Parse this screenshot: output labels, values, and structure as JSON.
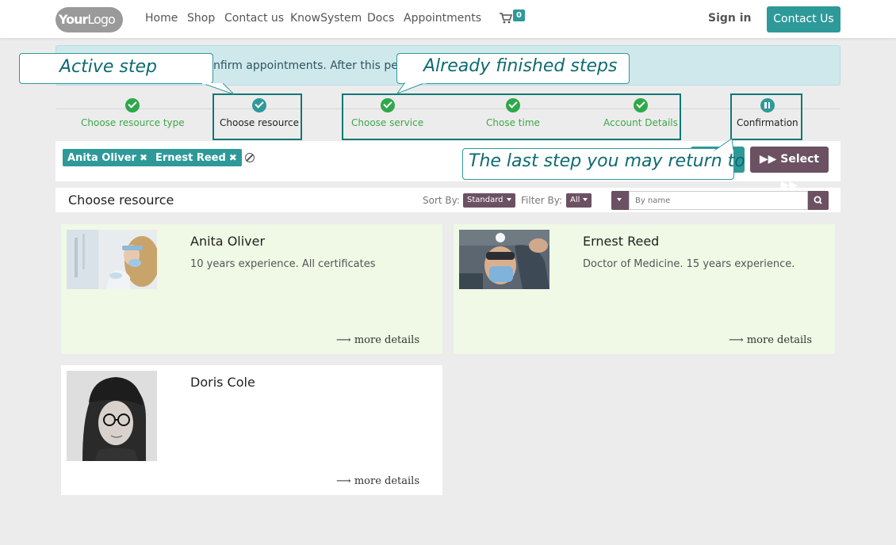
{
  "navbar": {
    "logo_bold": "Your",
    "logo_light": "Logo",
    "links": [
      "Home",
      "Shop",
      "Contact us",
      "KnowSystem",
      "Docs",
      "Appointments"
    ],
    "cart_count": "0",
    "signin": "Sign in",
    "contact": "Contact Us"
  },
  "alert": {
    "text": "nfirm appointments. After this perio"
  },
  "steps": [
    {
      "label": "Choose resource type",
      "state": "done"
    },
    {
      "label": "Choose resource",
      "state": "active"
    },
    {
      "label": "Choose service",
      "state": "done"
    },
    {
      "label": "Chose time",
      "state": "done"
    },
    {
      "label": "Account Details",
      "state": "done"
    },
    {
      "label": "Confirmation",
      "state": "current"
    }
  ],
  "callouts": {
    "active": "Active step",
    "finished": "Already finished steps",
    "last": "The last step you may return to"
  },
  "selection": {
    "tags": [
      "Anita Oliver",
      "Ernest Reed"
    ],
    "select_label": "Select"
  },
  "resources": {
    "title": "Choose resource",
    "sort_label": "Sort By:",
    "sort_value": "Standard",
    "filter_label": "Filter By:",
    "filter_value": "All",
    "search_placeholder": "By name"
  },
  "cards": [
    {
      "name": "Anita Oliver",
      "desc": "10 years experience. All certificates",
      "more": "more details",
      "selected": true
    },
    {
      "name": "Ernest Reed",
      "desc": "Doctor of Medicine. 15 years experience.",
      "more": "more details",
      "selected": true
    },
    {
      "name": "Doris Cole",
      "desc": "",
      "more": "more details",
      "selected": false
    }
  ],
  "colors": {
    "teal": "#2e9999",
    "mauve": "#6b5162",
    "done_green": "#2ea84a",
    "selected_card": "#eff9e6"
  }
}
